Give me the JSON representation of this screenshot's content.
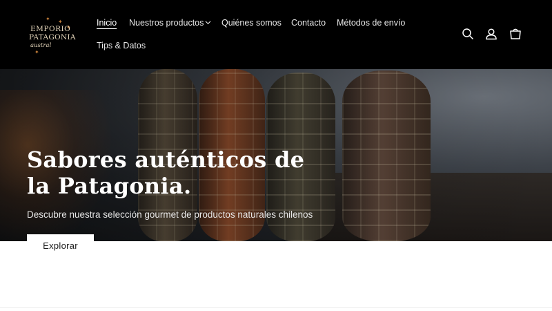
{
  "logo": {
    "line1": "EMPORIO",
    "line2": "PATAGONIA",
    "line3": "austral"
  },
  "nav": {
    "items": [
      {
        "label": "Inicio"
      },
      {
        "label": "Nuestros productos"
      },
      {
        "label": "Quiénes somos"
      },
      {
        "label": "Contacto"
      },
      {
        "label": "Métodos de envío"
      },
      {
        "label": "Tips & Datos"
      }
    ]
  },
  "header_icons": [
    "search-icon",
    "account-icon",
    "cart-icon"
  ],
  "hero": {
    "title": "Sabores auténticos de la Patagonia.",
    "subtitle": "Descubre nuestra selección gourmet de productos naturales chilenos",
    "button": "Explorar"
  },
  "colors": {
    "header_bg": "#000000",
    "logo": "#e6d7bc",
    "accent_star": "#c8803a",
    "button_bg": "#ffffff"
  }
}
